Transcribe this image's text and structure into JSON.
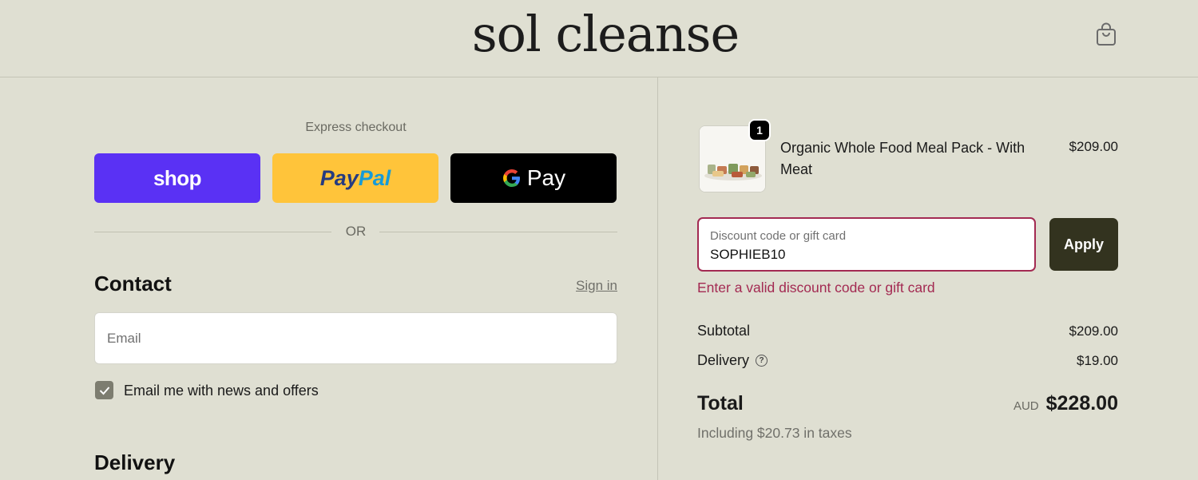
{
  "header": {
    "logo": "sol cleanse",
    "bag_icon": "shopping-bag-icon"
  },
  "express": {
    "label": "Express checkout",
    "shop_label": "shop",
    "paypal_label_1": "Pay",
    "paypal_label_2": "Pal",
    "gpay_label": "Pay",
    "or_label": "OR"
  },
  "contact": {
    "title": "Contact",
    "signin": "Sign in",
    "email_placeholder": "Email",
    "news_label": "Email me with news and offers",
    "news_checked": true
  },
  "delivery": {
    "title": "Delivery"
  },
  "order": {
    "item_name": "Organic Whole Food Meal Pack - With Meat",
    "item_qty": "1",
    "item_price": "$209.00",
    "discount_label": "Discount code or gift card",
    "discount_value": "SOPHIEB10",
    "apply_label": "Apply",
    "error": "Enter a valid discount code or gift card",
    "subtotal_label": "Subtotal",
    "subtotal_value": "$209.00",
    "delivery_label": "Delivery",
    "delivery_value": "$19.00",
    "total_label": "Total",
    "currency": "AUD",
    "total_value": "$228.00",
    "tax_text": "Including $20.73 in taxes"
  },
  "colors": {
    "background": "#dfdfd2",
    "shop": "#5a31f4",
    "paypal": "#ffc43a",
    "error": "#a32a52",
    "apply": "#33331f"
  }
}
